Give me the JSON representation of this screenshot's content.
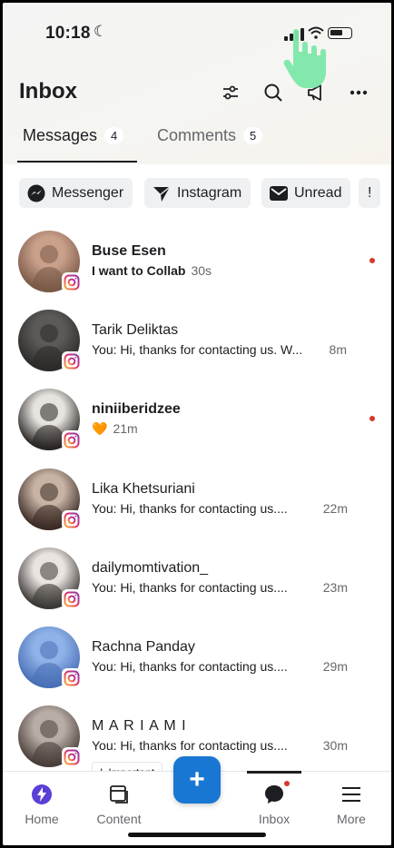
{
  "status_bar": {
    "time": "10:18",
    "moon": "☾"
  },
  "header": {
    "title": "Inbox"
  },
  "tabs": [
    {
      "label": "Messages",
      "count": "4"
    },
    {
      "label": "Comments",
      "count": "5"
    }
  ],
  "filters": [
    {
      "label": "Messenger",
      "icon": "messenger-icon"
    },
    {
      "label": "Instagram",
      "icon": "instagram-direct-icon"
    },
    {
      "label": "Unread",
      "icon": "mail-icon"
    },
    {
      "label": "!",
      "icon": "important-icon"
    }
  ],
  "conversations": [
    {
      "name": "Buse Esen",
      "preview": "I want to Collab",
      "time": "30s",
      "unread": true,
      "platform": "instagram"
    },
    {
      "name": "Tarik Deliktas",
      "preview": "You: Hi, thanks for contacting us. W...",
      "time": "8m",
      "unread": false,
      "platform": "instagram"
    },
    {
      "name": "niniiberidzee",
      "preview": "🧡",
      "time": "21m",
      "unread": true,
      "platform": "instagram"
    },
    {
      "name": "Lika Khetsuriani",
      "preview": "You: Hi, thanks for contacting us....",
      "time": "22m",
      "unread": false,
      "platform": "instagram"
    },
    {
      "name": "dailymomtivation_",
      "preview": "You: Hi, thanks for contacting us....",
      "time": "23m",
      "unread": false,
      "platform": "instagram"
    },
    {
      "name": "Rachna Panday",
      "preview": "You: Hi, thanks for contacting us....",
      "time": "29m",
      "unread": false,
      "platform": "instagram"
    },
    {
      "name": "M A R I A M I",
      "preview": "You: Hi, thanks for contacting us....",
      "time": "30m",
      "unread": false,
      "platform": "instagram",
      "label": "Important",
      "label_icon": "!"
    }
  ],
  "fab": {
    "label": "+"
  },
  "bottom_nav": [
    {
      "label": "Home",
      "icon": "home-bolt-icon"
    },
    {
      "label": "Content",
      "icon": "content-icon"
    },
    {
      "label": "Inbox",
      "icon": "chat-bubble-icon",
      "active": true
    },
    {
      "label": "More",
      "icon": "menu-icon"
    }
  ],
  "colors": {
    "accent": "#1877d2",
    "unread_dot": "#d43a2a",
    "home_icon": "#5b3fd6",
    "cursor": "#7ce7a8"
  }
}
